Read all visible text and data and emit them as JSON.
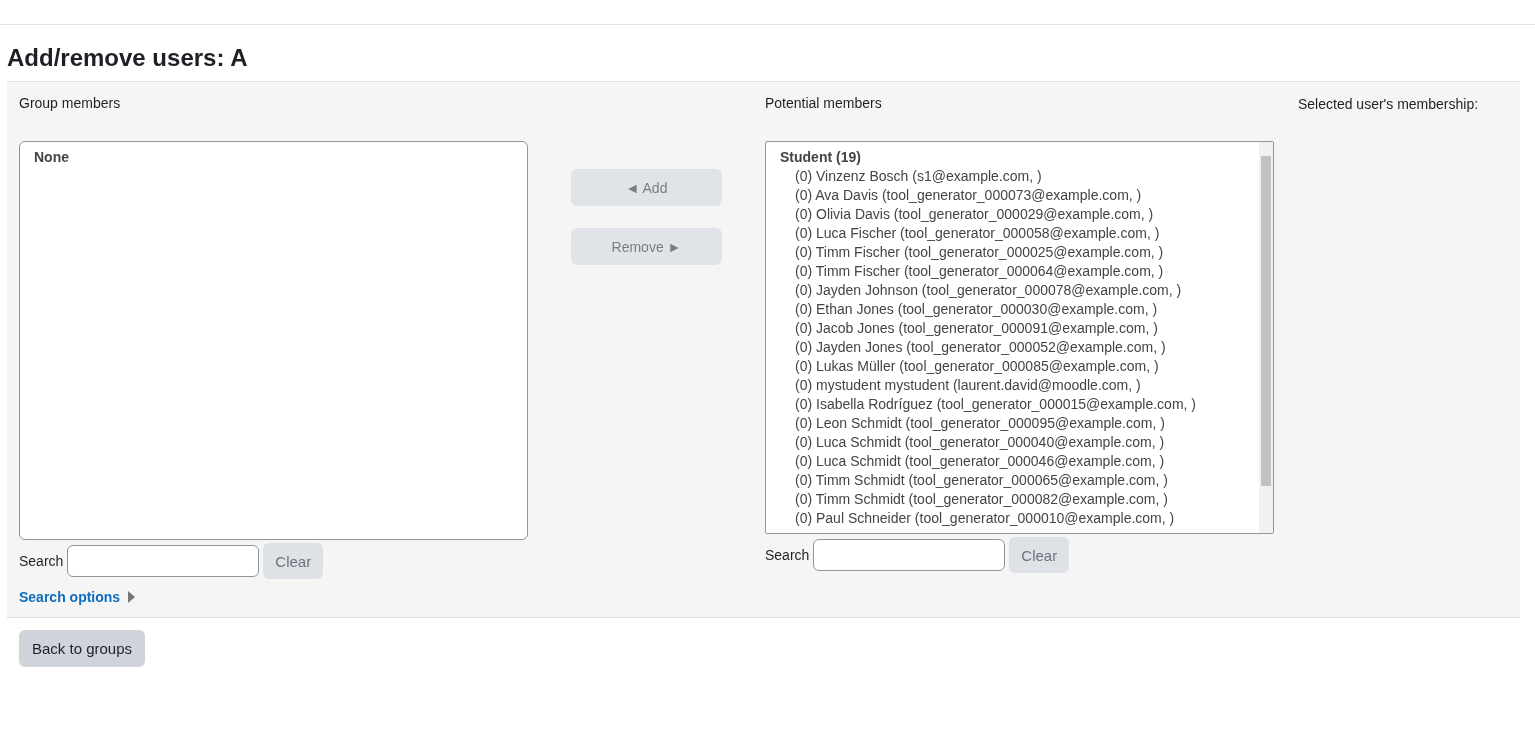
{
  "page_title": "Add/remove users: A",
  "group_members": {
    "label": "Group members",
    "options": [
      {
        "label": "None",
        "kind": "group"
      }
    ],
    "search_label": "Search",
    "clear_button": "Clear",
    "search_options_link": "Search options"
  },
  "actions": [
    {
      "label": "◄ Add",
      "disabled": true
    },
    {
      "label": "Remove ►",
      "disabled": true
    }
  ],
  "potential_members": {
    "label": "Potential members",
    "options": [
      {
        "label": "Student (19)",
        "kind": "group"
      },
      {
        "label": "(0) Vinzenz Bosch (s1@example.com, )",
        "kind": "user"
      },
      {
        "label": "(0) Ava Davis (tool_generator_000073@example.com, )",
        "kind": "user"
      },
      {
        "label": "(0) Olivia Davis (tool_generator_000029@example.com, )",
        "kind": "user"
      },
      {
        "label": "(0) Luca Fischer (tool_generator_000058@example.com, )",
        "kind": "user"
      },
      {
        "label": "(0) Timm Fischer (tool_generator_000025@example.com, )",
        "kind": "user"
      },
      {
        "label": "(0) Timm Fischer (tool_generator_000064@example.com, )",
        "kind": "user"
      },
      {
        "label": "(0) Jayden Johnson (tool_generator_000078@example.com, )",
        "kind": "user"
      },
      {
        "label": "(0) Ethan Jones (tool_generator_000030@example.com, )",
        "kind": "user"
      },
      {
        "label": "(0) Jacob Jones (tool_generator_000091@example.com, )",
        "kind": "user"
      },
      {
        "label": "(0) Jayden Jones (tool_generator_000052@example.com, )",
        "kind": "user"
      },
      {
        "label": "(0) Lukas Müller (tool_generator_000085@example.com, )",
        "kind": "user"
      },
      {
        "label": "(0) mystudent mystudent (laurent.david@moodle.com, )",
        "kind": "user"
      },
      {
        "label": "(0) Isabella Rodríguez (tool_generator_000015@example.com, )",
        "kind": "user"
      },
      {
        "label": "(0) Leon Schmidt (tool_generator_000095@example.com, )",
        "kind": "user"
      },
      {
        "label": "(0) Luca Schmidt (tool_generator_000040@example.com, )",
        "kind": "user"
      },
      {
        "label": "(0) Luca Schmidt (tool_generator_000046@example.com, )",
        "kind": "user"
      },
      {
        "label": "(0) Timm Schmidt (tool_generator_000065@example.com, )",
        "kind": "user"
      },
      {
        "label": "(0) Timm Schmidt (tool_generator_000082@example.com, )",
        "kind": "user"
      },
      {
        "label": "(0) Paul Schneider (tool_generator_000010@example.com, )",
        "kind": "user"
      }
    ],
    "search_label": "Search",
    "clear_button": "Clear"
  },
  "membership": {
    "label": "Selected user's membership:"
  },
  "back_button": "Back to groups"
}
